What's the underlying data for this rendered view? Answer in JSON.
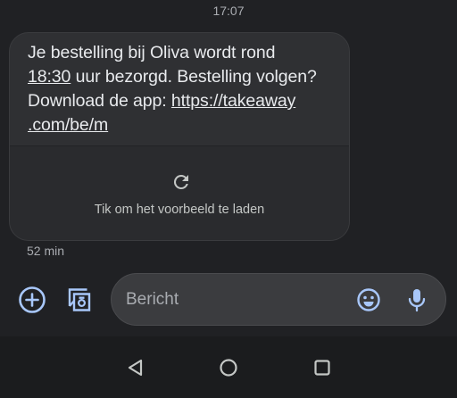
{
  "conversation": {
    "timestamp": "17:07",
    "message": {
      "line1": "Je bestelling bij Oliva wordt rond",
      "time_link": "18:30",
      "line2_rest": " uur bezorgd. Bestelling volgen?",
      "line3_prefix": "Download de app: ",
      "url_part1": "https://takeaway",
      "url_part2": ".com/be/m"
    },
    "preview": {
      "label": "Tik om het voorbeeld te laden",
      "icon": "refresh-icon"
    },
    "age": "52 min"
  },
  "composer": {
    "placeholder": "Bericht",
    "value": "",
    "icons": [
      "add-circle-icon",
      "gallery-icon",
      "emoji-icon",
      "mic-icon"
    ]
  },
  "navbar": {
    "icons": [
      "back-icon",
      "home-icon",
      "recents-icon"
    ]
  },
  "colors": {
    "background": "#202124",
    "bubble": "#2f3033",
    "accent": "#a8c7fa",
    "text": "#e8eaed"
  }
}
